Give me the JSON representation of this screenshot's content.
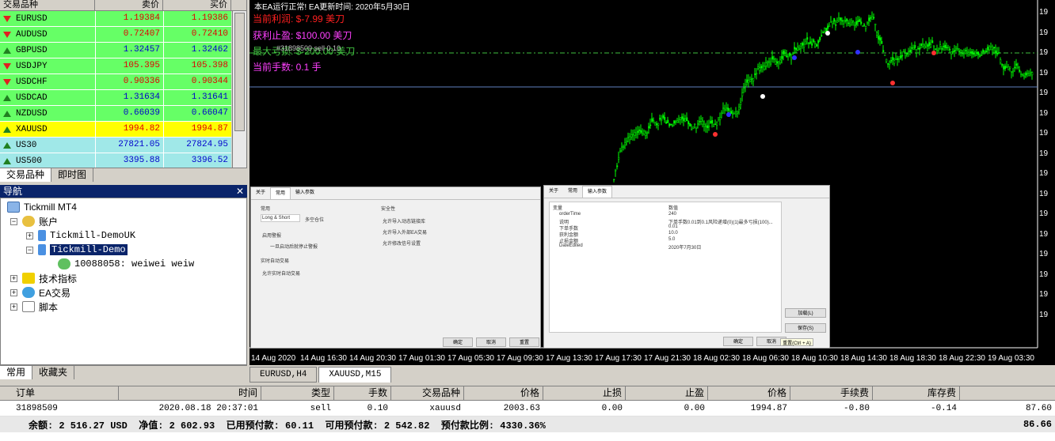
{
  "market_watch": {
    "headers": [
      "交易品种",
      "卖价",
      "买价"
    ],
    "rows": [
      {
        "symbol": "EURUSD",
        "bid": "1.19384",
        "ask": "1.19386",
        "bg": "#66ff66",
        "dir": "down",
        "color": "#e00000"
      },
      {
        "symbol": "AUDUSD",
        "bid": "0.72407",
        "ask": "0.72410",
        "bg": "#66ff66",
        "dir": "down",
        "color": "#e00000"
      },
      {
        "symbol": "GBPUSD",
        "bid": "1.32457",
        "ask": "1.32462",
        "bg": "#66ff66",
        "dir": "up",
        "color": "#0000cc"
      },
      {
        "symbol": "USDJPY",
        "bid": "105.395",
        "ask": "105.398",
        "bg": "#66ff66",
        "dir": "down",
        "color": "#e00000"
      },
      {
        "symbol": "USDCHF",
        "bid": "0.90336",
        "ask": "0.90344",
        "bg": "#66ff66",
        "dir": "down",
        "color": "#e00000"
      },
      {
        "symbol": "USDCAD",
        "bid": "1.31634",
        "ask": "1.31641",
        "bg": "#66ff66",
        "dir": "up",
        "color": "#0000cc"
      },
      {
        "symbol": "NZDUSD",
        "bid": "0.66039",
        "ask": "0.66047",
        "bg": "#66ff66",
        "dir": "up",
        "color": "#0000cc"
      },
      {
        "symbol": "XAUUSD",
        "bid": "1994.82",
        "ask": "1994.87",
        "bg": "#ffff00",
        "dir": "up",
        "color": "#e00000"
      },
      {
        "symbol": "US30",
        "bid": "27821.05",
        "ask": "27824.95",
        "bg": "#a0e8e8",
        "dir": "up",
        "color": "#0000cc"
      },
      {
        "symbol": "US500",
        "bid": "3395.88",
        "ask": "3396.52",
        "bg": "#a0e8e8",
        "dir": "up",
        "color": "#0000cc"
      }
    ],
    "tabs": [
      "交易品种",
      "即时图"
    ]
  },
  "navigator": {
    "title": "导航",
    "close": "✕",
    "root": "Tickmill MT4",
    "accounts": "账户",
    "server1": "Tickmill-DemoUK",
    "server2": "Tickmill-Demo",
    "account": "10088058: weiwei weiw",
    "indicators": "技术指标",
    "experts": "EA交易",
    "scripts": "脚本",
    "tabs": [
      "常用",
      "收藏夹"
    ]
  },
  "chart": {
    "status": "本EA运行正常! EA更新时间: 2020年5月30日",
    "profit_label": "当前利润: $-7.99 美刀",
    "tp_label": "获利止盈: $100.00 美刀",
    "sl_label": "最大亏损: $-200.00 美刀",
    "lots_label": "当前手数: 0.1 手",
    "order_tag": "#31898509 sell 0.10",
    "x_labels": [
      "14 Aug 2020",
      "14 Aug 16:30",
      "14 Aug 20:30",
      "17 Aug 01:30",
      "17 Aug 05:30",
      "17 Aug 09:30",
      "17 Aug 13:30",
      "17 Aug 17:30",
      "17 Aug 21:30",
      "18 Aug 02:30",
      "18 Aug 06:30",
      "18 Aug 10:30",
      "18 Aug 14:30",
      "18 Aug 18:30",
      "18 Aug 22:30",
      "19 Aug 03:30"
    ],
    "y_labels": [
      "19",
      "19",
      "19",
      "19",
      "19",
      "19",
      "19",
      "19",
      "19",
      "19",
      "19",
      "19",
      "19",
      "19",
      "19",
      "19"
    ],
    "tabs": [
      "EURUSD,H4",
      "XAUUSD,M15"
    ]
  },
  "dialog_left": {
    "tabs": [
      "关于",
      "常用",
      "输入参数"
    ],
    "group1": "常用",
    "positions": "Long & Short",
    "positions_label": "多空仓位",
    "alert": "启用警报",
    "once": "一旦启动后就停止警报",
    "group2": "实时自动交易",
    "live": "允许实时自动交易",
    "group3": "安全性",
    "dll": "允许导入动态链接库",
    "import": "允许导入外部EA交易",
    "modify": "允许修改信号设置",
    "ok": "确定",
    "cancel": "取消",
    "reset": "重置"
  },
  "dialog_right": {
    "tabs": [
      "关于",
      "常用",
      "输入参数"
    ],
    "col1": "变量",
    "col2": "数值",
    "rows": [
      [
        "orderTime",
        "240"
      ],
      [
        "说明",
        "下单手数0.01到0.1风险递增(0)(1)最多亏损(100)..."
      ],
      [
        "下单手数",
        "0.01"
      ],
      [
        "获利金额",
        "10.0"
      ],
      [
        "止损金额",
        "5.0"
      ],
      [
        "DateEdited",
        "2020年7月30日"
      ]
    ],
    "load": "加载(L)",
    "save": "保存(S)",
    "ok": "确定",
    "cancel": "取消",
    "reset": "重置(Ctrl + A)"
  },
  "terminal": {
    "headers": [
      "订单",
      "时间",
      "类型",
      "手数",
      "交易品种",
      "价格",
      "止损",
      "止盈",
      "价格",
      "手续费",
      "库存费"
    ],
    "order": {
      "ticket": "31898509",
      "time": "2020.08.18 20:37:01",
      "type": "sell",
      "lots": "0.10",
      "symbol": "xauusd",
      "price": "2003.63",
      "sl": "0.00",
      "tp": "0.00",
      "cur_price": "1994.87",
      "commission": "-0.80",
      "swap": "-0.14",
      "profit": "87.60"
    },
    "balance_line": "余额: 2 516.27 USD  净值: 2 602.93  已用预付款: 60.11  可用预付款: 2 542.82  预付款比例: 4330.36%",
    "balance_profit": "86.66"
  }
}
